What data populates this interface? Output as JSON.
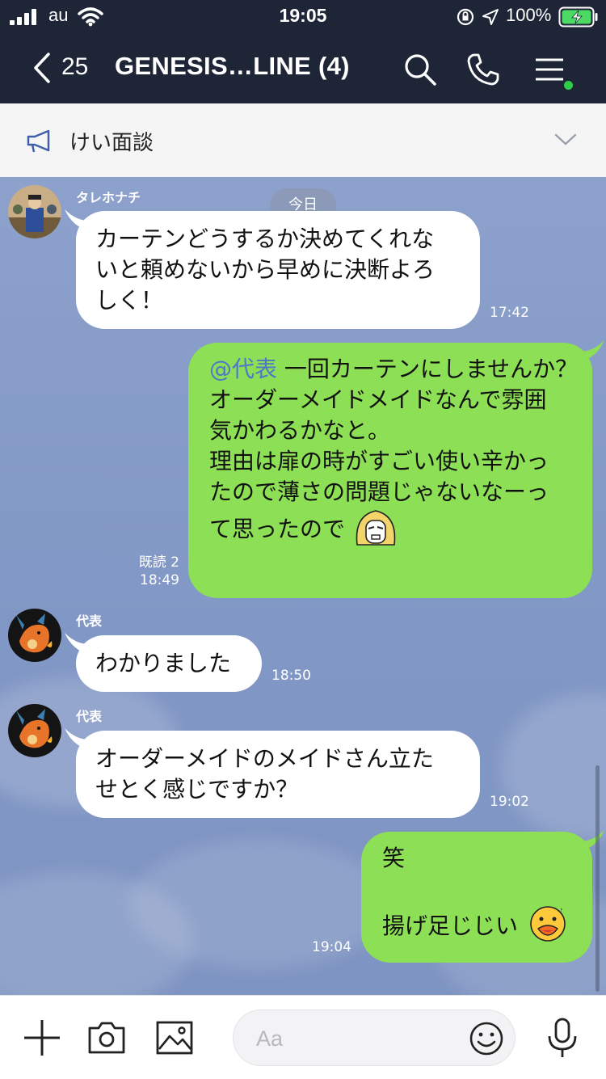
{
  "status_bar": {
    "carrier": "au",
    "time": "19:05",
    "battery": "100%"
  },
  "header": {
    "back_count": "25",
    "title": "GENESIS…LINE (4)",
    "icons": [
      "search-icon",
      "phone-icon",
      "menu-icon"
    ]
  },
  "announcement": {
    "text": "けい面談",
    "icons": [
      "megaphone-icon",
      "chevron-down-icon"
    ]
  },
  "chat": {
    "date_label": "今日",
    "messages": [
      {
        "direction": "incoming",
        "sender": "タレホナチ",
        "lines": [
          "カーテンどうするか決めてくれな",
          "いと頼めないから早めに決断よろ",
          "しく！"
        ],
        "time": "17:42"
      },
      {
        "direction": "outgoing",
        "mention": "@代表",
        "lines": [
          " 一回カーテンにしませんか？",
          "オーダーメイドメイドなんで雰囲",
          "気かわるかなと。",
          "理由は扉の時がすごい使い辛かっ",
          "たので薄さの問題じゃないなーっ",
          "て思ったので"
        ],
        "read": "既読 2",
        "time": "18:49",
        "sticker": "blonde-character-emoji"
      },
      {
        "direction": "incoming",
        "sender": "代表",
        "lines": [
          "わかりました"
        ],
        "time": "18:50"
      },
      {
        "direction": "incoming",
        "sender": "代表",
        "lines": [
          "オーダーメイドのメイドさん立た",
          "せとく感じですか？"
        ],
        "time": "19:02"
      },
      {
        "direction": "outgoing",
        "lines": [
          "笑",
          "",
          "揚げ足じじい"
        ],
        "time": "19:04",
        "sticker": "sally-emoji"
      }
    ]
  },
  "input_bar": {
    "placeholder": "Aa",
    "icons": [
      "plus-icon",
      "camera-icon",
      "image-icon",
      "emoji-icon",
      "microphone-icon"
    ]
  },
  "colors": {
    "header_bg": "#1d2536",
    "outgoing_bubble": "#8de055",
    "incoming_bubble": "#ffffff",
    "chat_bg": "#8197c5",
    "mention": "#4e76c9"
  }
}
